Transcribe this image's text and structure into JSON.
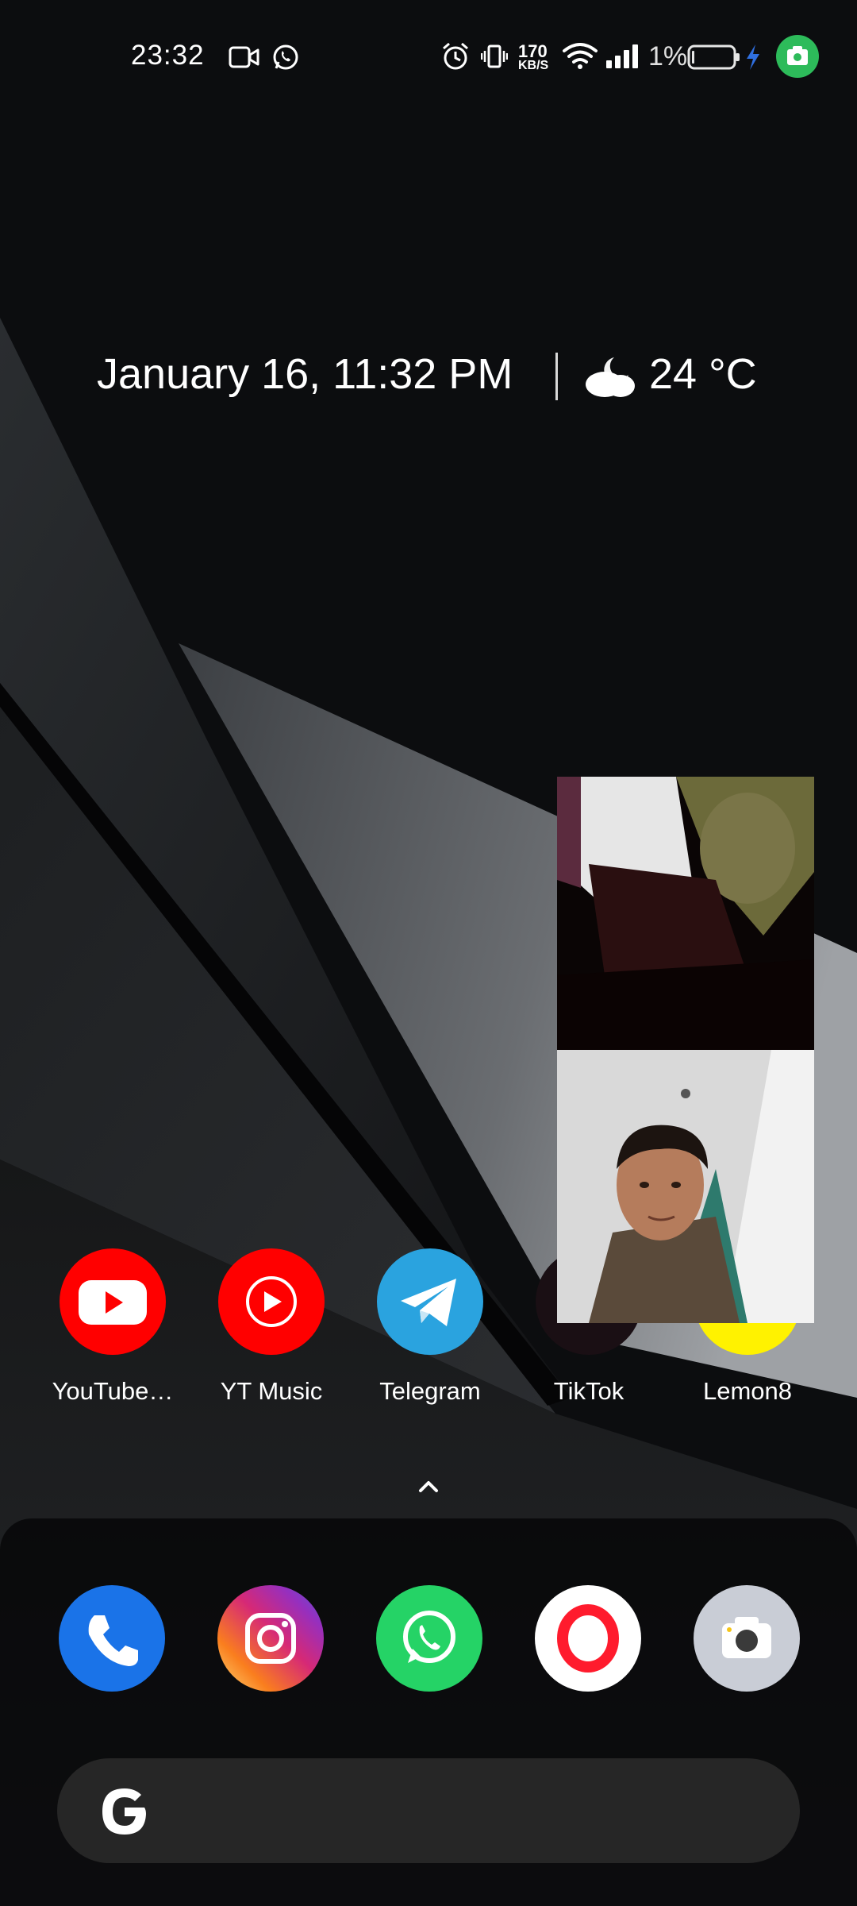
{
  "status_bar": {
    "time": "23:32",
    "left_icons": [
      "video-call-icon",
      "whatsapp-icon"
    ],
    "right_icons": [
      "alarm-icon",
      "vibrate-icon",
      "wifi-icon",
      "signal-icon",
      "battery-icon",
      "charging-icon",
      "screen-recorder-icon"
    ],
    "net_speed_value": "170",
    "net_speed_unit": "KB/S",
    "battery_percent": "1%"
  },
  "widget": {
    "date_time": "January 16, 11:32 PM",
    "weather_icon": "partly-cloudy-night-icon",
    "temperature": "24 °C"
  },
  "apps": [
    {
      "label": "YouTube…",
      "icon": "youtube-icon",
      "color": "#ff0000"
    },
    {
      "label": "YT Music",
      "icon": "yt-music-icon",
      "color": "#ff0000"
    },
    {
      "label": "Telegram",
      "icon": "telegram-icon",
      "color": "#2aa3df"
    },
    {
      "label": "TikTok",
      "icon": "tiktok-icon",
      "color": "#111111"
    },
    {
      "label": "Lemon8",
      "icon": "lemon8-icon",
      "color": "#fff200"
    }
  ],
  "app_drawer_hint": "chevron-up-icon",
  "dock": [
    {
      "name": "phone",
      "icon": "phone-icon",
      "color": "#1a73e8"
    },
    {
      "name": "instagram",
      "icon": "instagram-icon",
      "color": "#d62976"
    },
    {
      "name": "whatsapp",
      "icon": "whatsapp-icon",
      "color": "#25d366"
    },
    {
      "name": "opera",
      "icon": "opera-icon",
      "color": "#ff1b2d"
    },
    {
      "name": "camera",
      "icon": "camera-icon",
      "color": "#c9cdd6"
    }
  ],
  "search_bar": {
    "icon": "google-g-icon"
  },
  "video_call_pip": {
    "remote_feed": "remote-video-feed",
    "self_feed": "self-video-feed"
  }
}
